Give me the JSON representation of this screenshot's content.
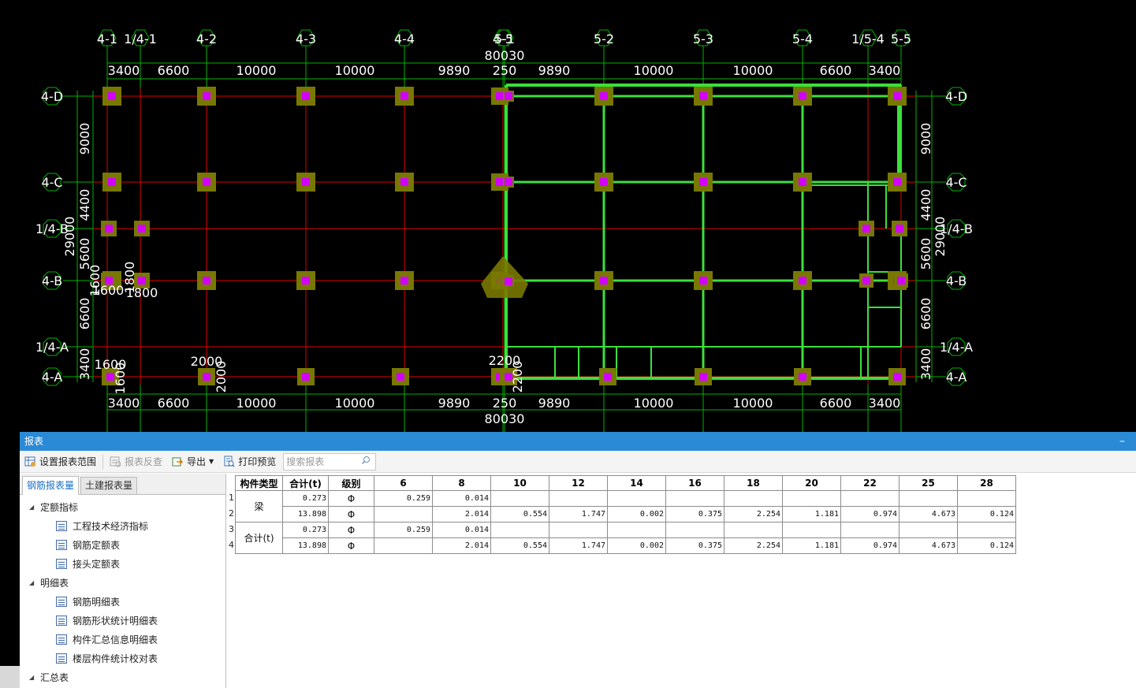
{
  "cad": {
    "top_axis_labels": [
      "4-1",
      "1/4-1",
      "4-2",
      "4-3",
      "4-4",
      "4-5",
      "5-1",
      "5-2",
      "5-3",
      "5-4",
      "1/5-4",
      "5-5"
    ],
    "top_dimensions": [
      "3400",
      "6600",
      "10000",
      "10000",
      "9890",
      "250",
      "9890",
      "10000",
      "10000",
      "6600",
      "3400"
    ],
    "bottom_dimensions": [
      "3400",
      "6600",
      "10000",
      "10000",
      "9890",
      "250",
      "9890",
      "10000",
      "10000",
      "6600",
      "3400"
    ],
    "overall_dimension": "80030",
    "row_axis_labels": [
      "4-D",
      "4-C",
      "1/4-B",
      "4-B",
      "1/4-A",
      "4-A"
    ],
    "left_dimensions": [
      "9000",
      "4400",
      "5600",
      "6600",
      "3400"
    ],
    "right_dimensions": [
      "9000",
      "4400",
      "5600",
      "6600",
      "3400"
    ],
    "side_total": "29000",
    "footing_labels": [
      "1600",
      "1800",
      "1600",
      "2000",
      "2000",
      "2200",
      "2200"
    ]
  },
  "report": {
    "title": "报表",
    "minimize": "–",
    "toolbar": {
      "set_range": "设置报表范围",
      "reverse_check": "报表反查",
      "export": "导出",
      "print_preview": "打印预览",
      "search_placeholder": "搜索报表"
    },
    "tabs": [
      "钢筋报表量",
      "土建报表量"
    ],
    "tree": {
      "group1": "定额指标",
      "group1_items": [
        "工程技术经济指标",
        "钢筋定额表",
        "接头定额表"
      ],
      "group2": "明细表",
      "group2_items": [
        "钢筋明细表",
        "钢筋形状统计明细表",
        "构件汇总信息明细表",
        "楼层构件统计校对表"
      ],
      "group3": "汇总表"
    },
    "table": {
      "headers": [
        "构件类型",
        "合计(t)",
        "级别",
        "6",
        "8",
        "10",
        "12",
        "14",
        "16",
        "18",
        "20",
        "22",
        "25",
        "28"
      ],
      "row_numbers": [
        "1",
        "2",
        "3",
        "4"
      ],
      "groups": [
        {
          "type": "梁",
          "rows": [
            {
              "total": "0.273",
              "grade": "Φ",
              "values": [
                "0.259",
                "0.014",
                "",
                "",
                "",
                "",
                "",
                "",
                "",
                "",
                ""
              ]
            },
            {
              "total": "13.898",
              "grade": "Φ",
              "values": [
                "",
                "2.014",
                "0.554",
                "1.747",
                "0.002",
                "0.375",
                "2.254",
                "1.181",
                "0.974",
                "4.673",
                "0.124"
              ]
            }
          ]
        },
        {
          "type": "合计(t)",
          "rows": [
            {
              "total": "0.273",
              "grade": "Φ",
              "values": [
                "0.259",
                "0.014",
                "",
                "",
                "",
                "",
                "",
                "",
                "",
                "",
                ""
              ]
            },
            {
              "total": "13.898",
              "grade": "Φ",
              "values": [
                "",
                "2.014",
                "0.554",
                "1.747",
                "0.002",
                "0.375",
                "2.254",
                "1.181",
                "0.974",
                "4.673",
                "0.124"
              ]
            }
          ]
        }
      ]
    }
  }
}
